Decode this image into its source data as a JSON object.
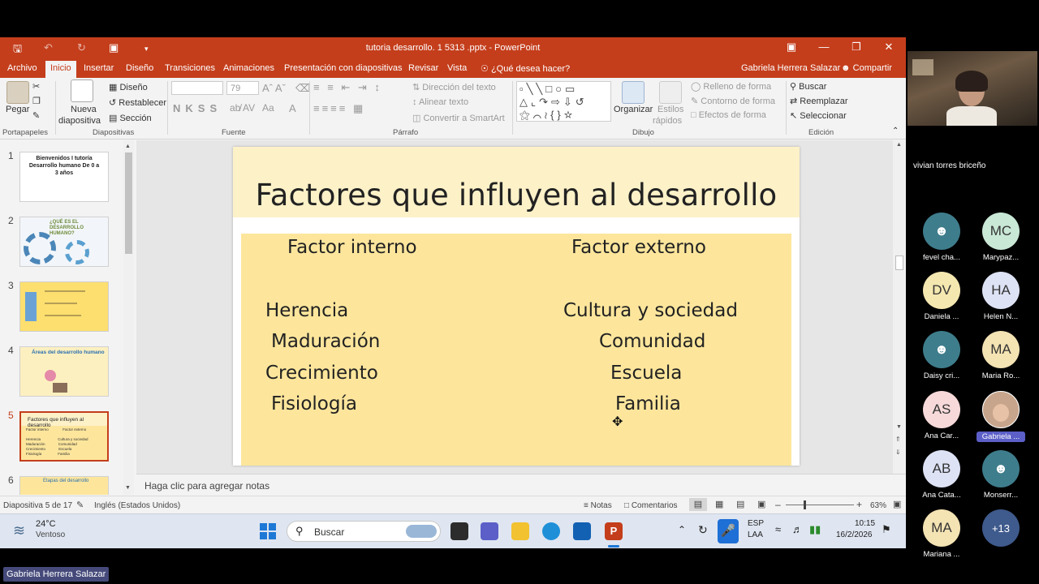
{
  "app": {
    "doc_title": "tutoria desarrollo. 1 5313 .pptx - PowerPoint",
    "user": "Gabriela Herrera Salazar",
    "share": "Compartir",
    "tell_me": "¿Qué desea hacer?"
  },
  "tabs": [
    "Archivo",
    "Inicio",
    "Insertar",
    "Diseño",
    "Transiciones",
    "Animaciones",
    "Presentación con diapositivas",
    "Revisar",
    "Vista"
  ],
  "ribbon": {
    "pegar": "Pegar",
    "portapapeles": "Portapapeles",
    "nueva": "Nueva",
    "diapositiva": "diapositiva",
    "diseno": "Diseño",
    "restablecer": "Restablecer",
    "seccion": "Sección",
    "diapositivas": "Diapositivas",
    "font_size": "79",
    "fuente": "Fuente",
    "direccion": "Dirección del texto",
    "alinear": "Alinear texto",
    "smartart": "Convertir a SmartArt",
    "parrafo": "Párrafo",
    "organizar": "Organizar",
    "estilos": "Estilos",
    "rapidos": "rápidos",
    "relleno": "Relleno de forma",
    "contorno": "Contorno de forma",
    "efectos": "Efectos de forma",
    "dibujo": "Dibujo",
    "buscar": "Buscar",
    "reemplazar": "Reemplazar",
    "seleccionar": "Seleccionar",
    "edicion": "Edición"
  },
  "thumbnails": [
    {
      "num": "1",
      "text": "Bienvenidos I tutoría Desarrollo humano De 0 a 3 años"
    },
    {
      "num": "2",
      "text": "¿QUÉ ES EL DESARROLLO HUMANO?"
    },
    {
      "num": "3",
      "text": ""
    },
    {
      "num": "4",
      "text": "Áreas del desarrollo humano"
    },
    {
      "num": "5",
      "text": "Factores que influyen al desarrollo"
    },
    {
      "num": "6",
      "text": "Etapas del desarrollo"
    }
  ],
  "slide": {
    "title": "Factores que influyen  al desarrollo",
    "left_head": "Factor interno",
    "right_head": "Factor externo",
    "left_items": [
      "Herencia",
      "Maduración",
      "Crecimiento",
      "Fisiología"
    ],
    "right_items": [
      "Cultura y sociedad",
      "Comunidad",
      "Escuela",
      "Familia"
    ]
  },
  "notes_placeholder": "Haga clic para agregar notas",
  "status": {
    "slide_of": "Diapositiva 5 de 17",
    "language": "Inglés (Estados Unidos)",
    "notas": "Notas",
    "comentarios": "Comentarios",
    "zoom": "63%"
  },
  "taskbar": {
    "temp": "24°C",
    "weather": "Ventoso",
    "search": "Buscar",
    "lang1": "ESP",
    "lang2": "LAA",
    "time": "10:15",
    "date": "16/2/2026"
  },
  "meeting": {
    "presenter": "vivian torres briceño",
    "participants": [
      {
        "initials": "",
        "name": "fevel cha...",
        "color": "#3e7d8c"
      },
      {
        "initials": "MC",
        "name": "Marypaz...",
        "color": "#c9e8d6"
      },
      {
        "initials": "DV",
        "name": "Daniela ...",
        "color": "#f4e7b0"
      },
      {
        "initials": "HA",
        "name": "Helen N...",
        "color": "#dde2f5"
      },
      {
        "initials": "",
        "name": "Daisy cri...",
        "color": "#3e7d8c"
      },
      {
        "initials": "MA",
        "name": "Maria Ro...",
        "color": "#f4e3b3"
      },
      {
        "initials": "AS",
        "name": "Ana Car...",
        "color": "#f7d9d9"
      },
      {
        "initials": "",
        "name": "Gabriela ...",
        "color": "#c7a58c"
      },
      {
        "initials": "AB",
        "name": "Ana Cata...",
        "color": "#dde2f5"
      },
      {
        "initials": "",
        "name": "Monserr...",
        "color": "#3e7d8c"
      },
      {
        "initials": "MA",
        "name": "Mariana ...",
        "color": "#f4e3b3"
      },
      {
        "initials": "+13",
        "name": "",
        "color": "#3f5a8c"
      }
    ],
    "bottom_name": "Gabriela Herrera Salazar"
  }
}
